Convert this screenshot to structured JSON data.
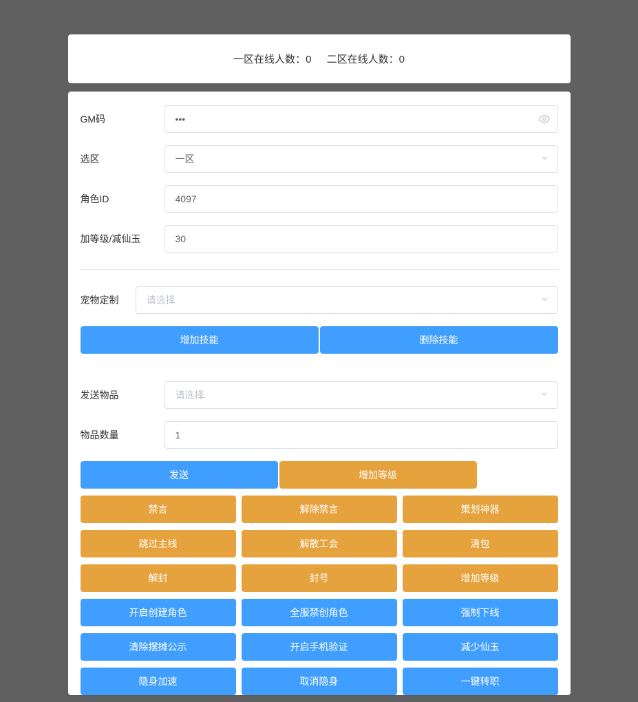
{
  "header": {
    "zone1_label": "一区在线人数：",
    "zone1_count": "0",
    "zone2_label": "二区在线人数：",
    "zone2_count": "0"
  },
  "form": {
    "gm_code": {
      "label": "GM码",
      "value": "•••"
    },
    "zone_select": {
      "label": "选区",
      "value": "一区"
    },
    "role_id": {
      "label": "角色ID",
      "value": "4097"
    },
    "level_jade": {
      "label": "加等级/减仙玉",
      "value": "30"
    },
    "pet_custom": {
      "label": "宠物定制",
      "placeholder": "请选择"
    },
    "send_item": {
      "label": "发送物品",
      "placeholder": "请选择"
    },
    "item_qty": {
      "label": "物品数量",
      "value": "1"
    }
  },
  "buttons": {
    "add_skill": "增加技能",
    "del_skill": "删除技能",
    "send": "发送",
    "add_level": "增加等级",
    "mute": "禁言",
    "unmute": "解除禁言",
    "planner_artifact": "策划神器",
    "skip_main": "跳过主线",
    "disband_guild": "解散工会",
    "clear_bag": "清包",
    "unban": "解封",
    "ban": "封号",
    "add_level2": "增加等级",
    "enable_create_role": "开启创建角色",
    "disable_create_role": "全服禁创角色",
    "force_offline": "强制下线",
    "clear_stall": "清除摆摊公示",
    "enable_phone_verify": "开启手机验证",
    "reduce_jade": "减少仙玉",
    "stealth_speed": "隐身加速",
    "cancel_stealth": "取消隐身",
    "one_click_transfer": "一键转职"
  }
}
